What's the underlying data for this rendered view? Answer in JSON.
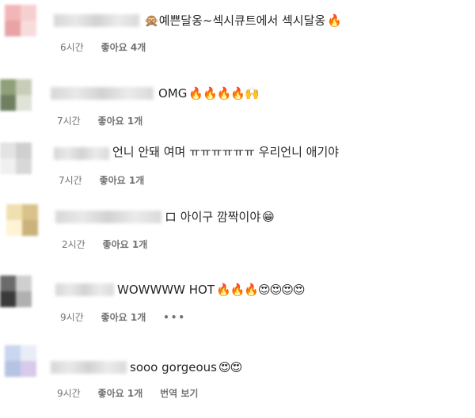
{
  "comments": [
    {
      "text": "예쁜달옹~섹시큐트에서 섹시달옹",
      "lead_emoji": "🙊",
      "emoji": "🔥",
      "time": "6시간",
      "likes": "좋아요 4개",
      "avatar_colors": [
        "#f2b6b8",
        "#f6d0d1",
        "#e9a3a6",
        "#f8dcdc"
      ]
    },
    {
      "text": "OMG",
      "lead_emoji": "",
      "emoji": "🔥🔥🔥🔥🙌",
      "time": "7시간",
      "likes": "좋아요 1개",
      "avatar_colors": [
        "#8fa07a",
        "#c7cdb8",
        "#6f7f60",
        "#dfe2d6"
      ]
    },
    {
      "text": "언니 안돼 여며 ㅠㅠㅠㅠㅠㅠ 우리언니 애기야",
      "lead_emoji": "",
      "emoji": "",
      "time": "7시간",
      "likes": "좋아요 1개",
      "avatar_colors": [
        "#e3e3e3",
        "#cfcfcf",
        "#f0f0f0",
        "#d8d8d8"
      ]
    },
    {
      "text": "ロ 아이구 깜짝이야",
      "lead_emoji": "",
      "emoji": "😁",
      "time": "2시간",
      "likes": "좋아요 1개",
      "avatar_colors": [
        "#f0e0b0",
        "#d9c28a",
        "#fff3d6",
        "#c9b27b"
      ]
    },
    {
      "text": "WOWWWW HOT",
      "lead_emoji": "",
      "emoji": "🔥🔥🔥😍😍😍😍",
      "time": "9시간",
      "likes": "좋아요 1개",
      "more": "•••",
      "avatar_colors": [
        "#6b6b6b",
        "#cfcfcf",
        "#3a3a3a",
        "#b0b0b0"
      ]
    },
    {
      "text": "sooo gorgeous",
      "lead_emoji": "",
      "emoji": "😍😍",
      "time": "9시간",
      "likes": "좋아요 1개",
      "translate": "번역 보기",
      "avatar_colors": [
        "#c9d6ef",
        "#e8edf7",
        "#b7c3e4",
        "#d9c9ea"
      ]
    }
  ],
  "colors": {
    "text": "#262626",
    "meta": "#737373"
  }
}
